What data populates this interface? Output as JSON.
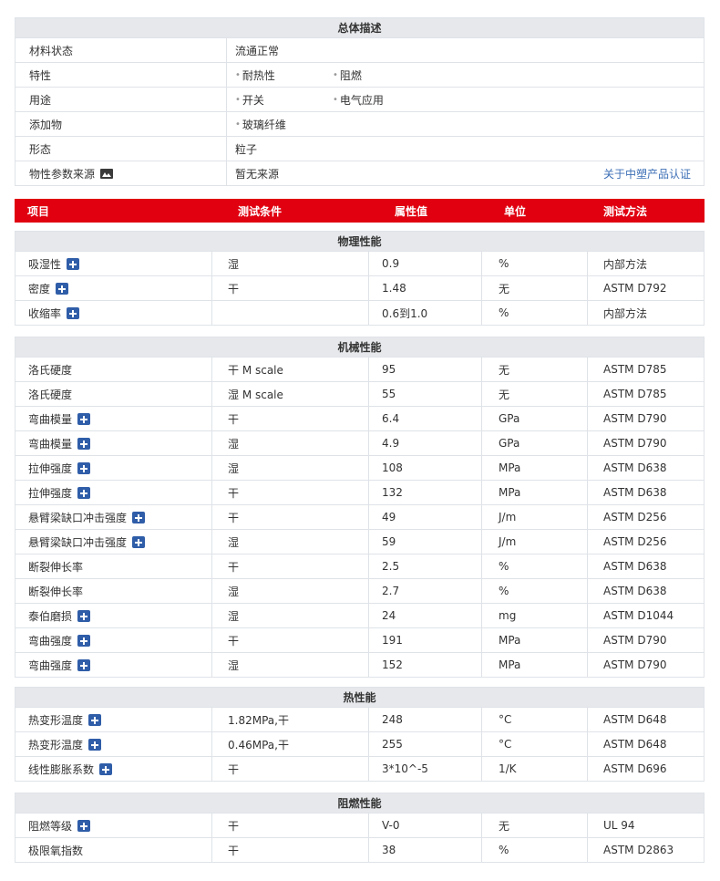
{
  "overview": {
    "title": "总体描述",
    "rows": [
      {
        "label": "材料状态",
        "value": "流通正常"
      },
      {
        "label": "特性",
        "tags": [
          "耐热性",
          "阻燃"
        ]
      },
      {
        "label": "用途",
        "tags": [
          "开关",
          "电气应用"
        ]
      },
      {
        "label": "添加物",
        "tags": [
          "玻璃纤维"
        ]
      },
      {
        "label": "形态",
        "value": "粒子"
      },
      {
        "label": "物性参数来源",
        "value": "暂无来源",
        "link": "关于中塑产品认证"
      }
    ]
  },
  "header": {
    "item": "项目",
    "condition": "测试条件",
    "value": "属性值",
    "unit": "单位",
    "method": "测试方法"
  },
  "sections": [
    {
      "title": "物理性能",
      "rows": [
        {
          "item": "吸湿性",
          "plus": true,
          "cond": "湿",
          "value": "0.9",
          "unit": "%",
          "method": "内部方法"
        },
        {
          "item": "密度",
          "plus": true,
          "cond": "干",
          "value": "1.48",
          "unit": "无",
          "method": "ASTM D792"
        },
        {
          "item": "收缩率",
          "plus": true,
          "cond": "",
          "value": "0.6到1.0",
          "unit": "%",
          "method": "内部方法"
        }
      ]
    },
    {
      "title": "机械性能",
      "rows": [
        {
          "item": "洛氏硬度",
          "plus": false,
          "cond": "干 M scale",
          "value": "95",
          "unit": "无",
          "method": "ASTM D785"
        },
        {
          "item": "洛氏硬度",
          "plus": false,
          "cond": "湿 M scale",
          "value": "55",
          "unit": "无",
          "method": "ASTM D785"
        },
        {
          "item": "弯曲模量",
          "plus": true,
          "cond": "干",
          "value": "6.4",
          "unit": "GPa",
          "method": "ASTM D790"
        },
        {
          "item": "弯曲模量",
          "plus": true,
          "cond": "湿",
          "value": "4.9",
          "unit": "GPa",
          "method": "ASTM D790"
        },
        {
          "item": "拉伸强度",
          "plus": true,
          "cond": "湿",
          "value": "108",
          "unit": "MPa",
          "method": "ASTM D638"
        },
        {
          "item": "拉伸强度",
          "plus": true,
          "cond": "干",
          "value": "132",
          "unit": "MPa",
          "method": "ASTM D638"
        },
        {
          "item": "悬臂梁缺口冲击强度",
          "plus": true,
          "cond": "干",
          "value": "49",
          "unit": "J/m",
          "method": "ASTM D256"
        },
        {
          "item": "悬臂梁缺口冲击强度",
          "plus": true,
          "cond": "湿",
          "value": "59",
          "unit": "J/m",
          "method": "ASTM D256"
        },
        {
          "item": "断裂伸长率",
          "plus": false,
          "cond": "干",
          "value": "2.5",
          "unit": "%",
          "method": "ASTM D638"
        },
        {
          "item": "断裂伸长率",
          "plus": false,
          "cond": "湿",
          "value": "2.7",
          "unit": "%",
          "method": "ASTM D638"
        },
        {
          "item": "泰伯磨损",
          "plus": true,
          "cond": "湿",
          "value": "24",
          "unit": "mg",
          "method": "ASTM D1044"
        },
        {
          "item": "弯曲强度",
          "plus": true,
          "cond": "干",
          "value": "191",
          "unit": "MPa",
          "method": "ASTM D790"
        },
        {
          "item": "弯曲强度",
          "plus": true,
          "cond": "湿",
          "value": "152",
          "unit": "MPa",
          "method": "ASTM D790"
        }
      ]
    },
    {
      "title": "热性能",
      "rows": [
        {
          "item": "热变形温度",
          "plus": true,
          "cond": "1.82MPa,干",
          "value": "248",
          "unit": "°C",
          "method": "ASTM D648"
        },
        {
          "item": "热变形温度",
          "plus": true,
          "cond": "0.46MPa,干",
          "value": "255",
          "unit": "°C",
          "method": "ASTM D648"
        },
        {
          "item": "线性膨胀系数",
          "plus": true,
          "cond": "干",
          "value": "3*10^-5",
          "unit": "1/K",
          "method": "ASTM D696"
        }
      ]
    },
    {
      "title": "阻燃性能",
      "rows": [
        {
          "item": "阻燃等级",
          "plus": true,
          "cond": "干",
          "value": "V-0",
          "unit": "无",
          "method": "UL 94"
        },
        {
          "item": "极限氧指数",
          "plus": false,
          "cond": "干",
          "value": "38",
          "unit": "%",
          "method": "ASTM D2863"
        }
      ]
    }
  ]
}
